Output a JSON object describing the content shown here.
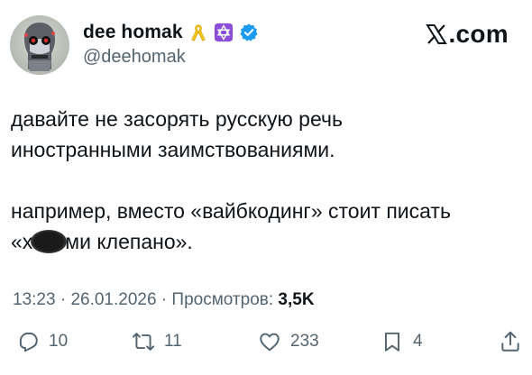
{
  "author": {
    "display_name": "dee homak",
    "handle": "@deehomak",
    "badges": [
      "yellow-ribbon-icon",
      "star-of-david-icon",
      "verified-icon"
    ]
  },
  "brand": {
    "text": ".com",
    "logo": "x-logo-icon"
  },
  "tweet": {
    "line1": "давайте не засорять русскую речь",
    "line2": "иностранными заимствованиями.",
    "line3": "например, вместо «вайбкодинг» стоит писать",
    "line4_pre": "«х",
    "line4_post": "ми клепано»."
  },
  "meta": {
    "time": "13:23",
    "sep1": " · ",
    "date": "26.01.2026",
    "sep2": " · ",
    "views_label": "Просмотров: ",
    "views_value": "3,5K"
  },
  "actions": {
    "replies": "10",
    "retweets": "11",
    "likes": "233",
    "bookmarks": "4"
  },
  "colors": {
    "text": "#0f1419",
    "secondary": "#536471",
    "verified": "#1d9bf0",
    "ribbon": "#f5c518",
    "star_badge": "#8a4fd8"
  }
}
